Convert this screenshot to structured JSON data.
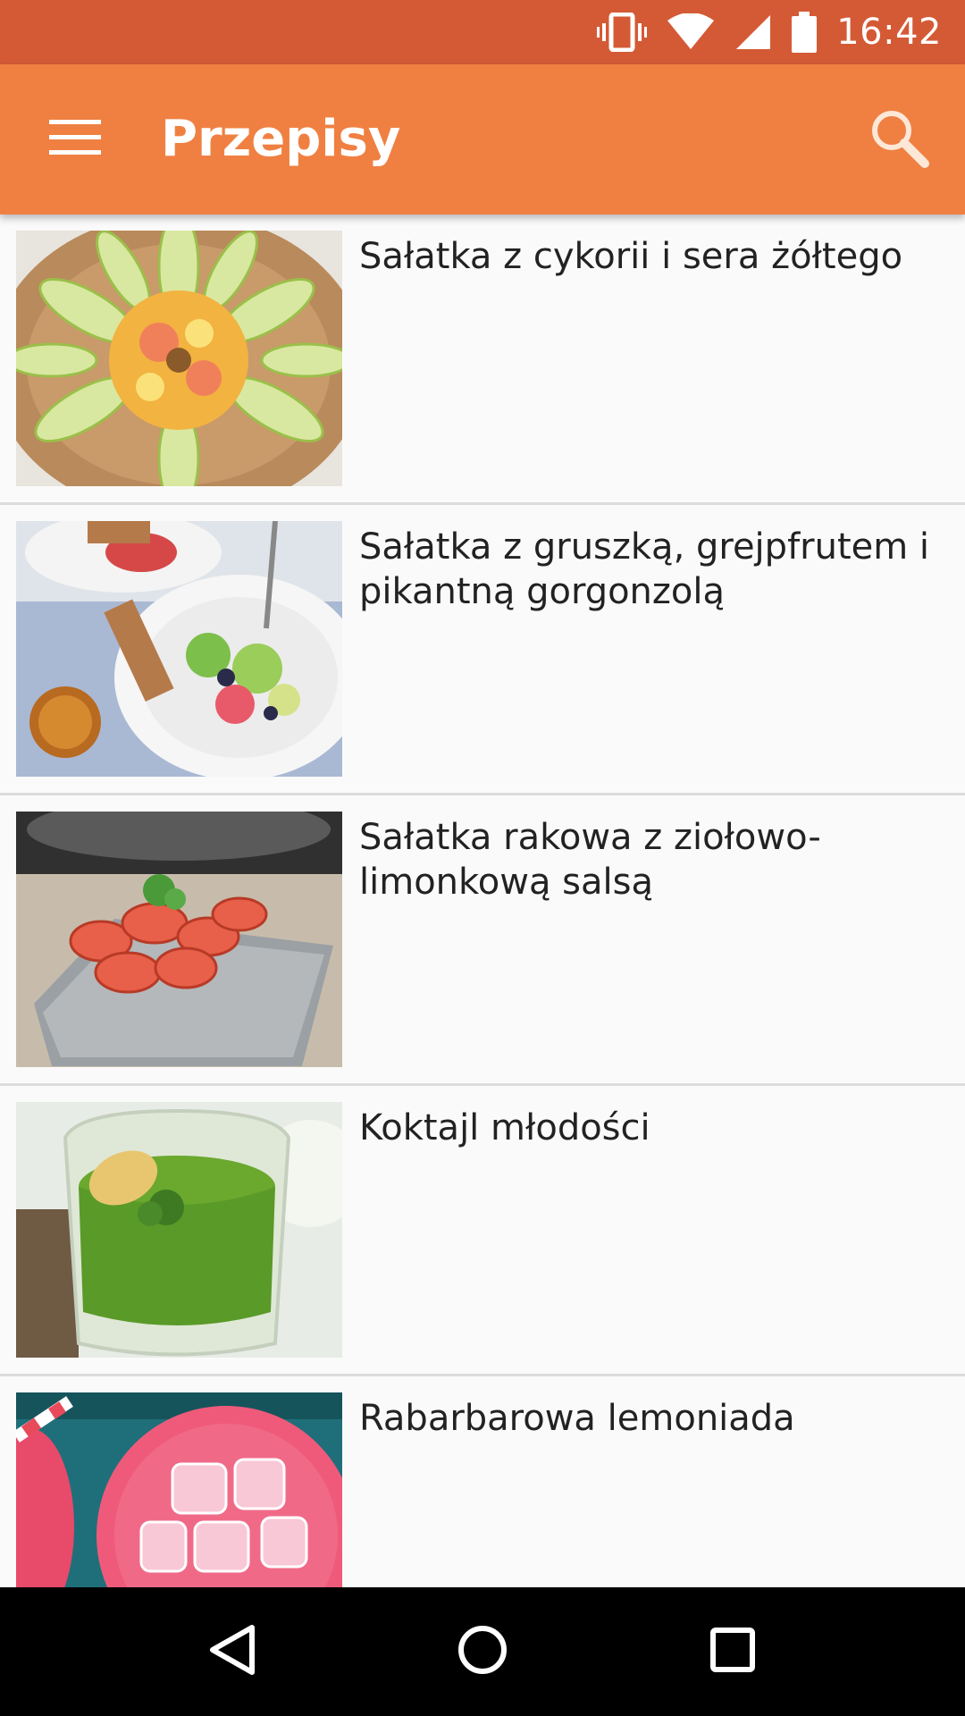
{
  "status_bar": {
    "time": "16:42",
    "icons": [
      "vibrate-icon",
      "wifi-icon",
      "signal-icon",
      "battery-icon"
    ]
  },
  "app_bar": {
    "title": "Przepisy",
    "menu_icon": "hamburger-menu-icon",
    "search_icon": "search-icon"
  },
  "recipes": [
    {
      "name": "Sałatka z cykorii i sera żółtego"
    },
    {
      "name": "Sałatka z gruszką, grejpfrutem i pikantną gorgonzolą"
    },
    {
      "name": "Sałatka rakowa z ziołowo-limonkową salsą"
    },
    {
      "name": "Koktajl młodości"
    },
    {
      "name": "Rabarbarowa lemoniada"
    }
  ],
  "nav_bar": {
    "icons": [
      "back-icon",
      "home-icon",
      "recents-icon"
    ]
  },
  "colors": {
    "status_bar": "#d45a36",
    "app_bar": "#f08042",
    "background": "#fafafa",
    "divider": "#dcdcdc"
  }
}
